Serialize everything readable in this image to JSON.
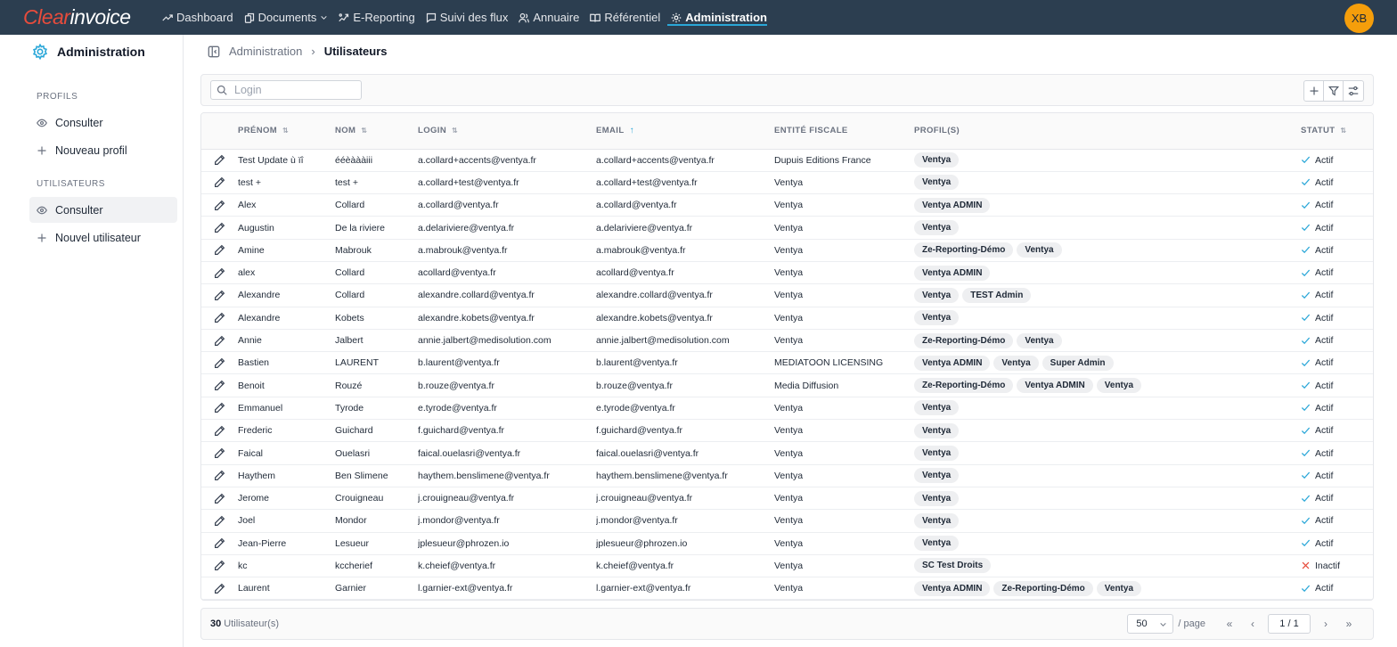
{
  "app": {
    "logo_a": "Clear",
    "logo_b": "invoice",
    "user_initials": "XB"
  },
  "nav": [
    {
      "label": "Dashboard",
      "icon": "trending-up-icon"
    },
    {
      "label": "Documents",
      "icon": "documents-icon",
      "dropdown": true
    },
    {
      "label": "E-Reporting",
      "icon": "e-reporting-icon"
    },
    {
      "label": "Suivi des flux",
      "icon": "message-icon"
    },
    {
      "label": "Annuaire",
      "icon": "users-icon"
    },
    {
      "label": "Référentiel",
      "icon": "book-icon"
    },
    {
      "label": "Administration",
      "icon": "gear-icon",
      "active": true
    }
  ],
  "sidebar": {
    "title": "Administration",
    "sections": [
      {
        "title": "PROFILS",
        "items": [
          {
            "label": "Consulter"
          },
          {
            "label": "Nouveau profil"
          }
        ]
      },
      {
        "title": "UTILISATEURS",
        "items": [
          {
            "label": "Consulter",
            "active": true
          },
          {
            "label": "Nouvel utilisateur"
          }
        ]
      }
    ]
  },
  "breadcrumb": {
    "parent": "Administration",
    "current": "Utilisateurs"
  },
  "search": {
    "placeholder": "Login",
    "value": ""
  },
  "table": {
    "columns": [
      "PRÉNOM",
      "NOM",
      "LOGIN",
      "EMAIL",
      "ENTITÉ FISCALE",
      "PROFIL(S)",
      "STATUT"
    ],
    "rows": [
      {
        "prenom": "Test Update ù ïî",
        "nom": "ééèàààiii",
        "login": "a.collard+accents@ventya.fr",
        "email": "a.collard+accents@ventya.fr",
        "entite": "Dupuis Editions France",
        "profils": [
          "Ventya"
        ],
        "statut": "Actif",
        "active": true
      },
      {
        "prenom": "test +",
        "nom": "test +",
        "login": "a.collard+test@ventya.fr",
        "email": "a.collard+test@ventya.fr",
        "entite": "Ventya",
        "profils": [
          "Ventya"
        ],
        "statut": "Actif",
        "active": true
      },
      {
        "prenom": "Alex",
        "nom": "Collard",
        "login": "a.collard@ventya.fr",
        "email": "a.collard@ventya.fr",
        "entite": "Ventya",
        "profils": [
          "Ventya ADMIN"
        ],
        "statut": "Actif",
        "active": true
      },
      {
        "prenom": "Augustin",
        "nom": "De la riviere",
        "login": "a.delariviere@ventya.fr",
        "email": "a.delariviere@ventya.fr",
        "entite": "Ventya",
        "profils": [
          "Ventya"
        ],
        "statut": "Actif",
        "active": true
      },
      {
        "prenom": "Amine",
        "nom": "Mabrouk",
        "login": "a.mabrouk@ventya.fr",
        "email": "a.mabrouk@ventya.fr",
        "entite": "Ventya",
        "profils": [
          "Ze-Reporting-Démo",
          "Ventya"
        ],
        "statut": "Actif",
        "active": true
      },
      {
        "prenom": "alex",
        "nom": "Collard",
        "login": "acollard@ventya.fr",
        "email": "acollard@ventya.fr",
        "entite": "Ventya",
        "profils": [
          "Ventya ADMIN"
        ],
        "statut": "Actif",
        "active": true
      },
      {
        "prenom": "Alexandre",
        "nom": "Collard",
        "login": "alexandre.collard@ventya.fr",
        "email": "alexandre.collard@ventya.fr",
        "entite": "Ventya",
        "profils": [
          "Ventya",
          "TEST Admin"
        ],
        "statut": "Actif",
        "active": true
      },
      {
        "prenom": "Alexandre",
        "nom": "Kobets",
        "login": "alexandre.kobets@ventya.fr",
        "email": "alexandre.kobets@ventya.fr",
        "entite": "Ventya",
        "profils": [
          "Ventya"
        ],
        "statut": "Actif",
        "active": true
      },
      {
        "prenom": "Annie",
        "nom": "Jalbert",
        "login": "annie.jalbert@medisolution.com",
        "email": "annie.jalbert@medisolution.com",
        "entite": "Ventya",
        "profils": [
          "Ze-Reporting-Démo",
          "Ventya"
        ],
        "statut": "Actif",
        "active": true
      },
      {
        "prenom": "Bastien",
        "nom": "LAURENT",
        "login": "b.laurent@ventya.fr",
        "email": "b.laurent@ventya.fr",
        "entite": "MEDIATOON LICENSING",
        "profils": [
          "Ventya ADMIN",
          "Ventya",
          "Super Admin"
        ],
        "statut": "Actif",
        "active": true
      },
      {
        "prenom": "Benoit",
        "nom": "Rouzé",
        "login": "b.rouze@ventya.fr",
        "email": "b.rouze@ventya.fr",
        "entite": "Media Diffusion",
        "profils": [
          "Ze-Reporting-Démo",
          "Ventya ADMIN",
          "Ventya"
        ],
        "statut": "Actif",
        "active": true
      },
      {
        "prenom": "Emmanuel",
        "nom": "Tyrode",
        "login": "e.tyrode@ventya.fr",
        "email": "e.tyrode@ventya.fr",
        "entite": "Ventya",
        "profils": [
          "Ventya"
        ],
        "statut": "Actif",
        "active": true
      },
      {
        "prenom": "Frederic",
        "nom": "Guichard",
        "login": "f.guichard@ventya.fr",
        "email": "f.guichard@ventya.fr",
        "entite": "Ventya",
        "profils": [
          "Ventya"
        ],
        "statut": "Actif",
        "active": true
      },
      {
        "prenom": "Faical",
        "nom": "Ouelasri",
        "login": "faical.ouelasri@ventya.fr",
        "email": "faical.ouelasri@ventya.fr",
        "entite": "Ventya",
        "profils": [
          "Ventya"
        ],
        "statut": "Actif",
        "active": true
      },
      {
        "prenom": "Haythem",
        "nom": "Ben Slimene",
        "login": "haythem.benslimene@ventya.fr",
        "email": "haythem.benslimene@ventya.fr",
        "entite": "Ventya",
        "profils": [
          "Ventya"
        ],
        "statut": "Actif",
        "active": true
      },
      {
        "prenom": "Jerome",
        "nom": "Crouigneau",
        "login": "j.crouigneau@ventya.fr",
        "email": "j.crouigneau@ventya.fr",
        "entite": "Ventya",
        "profils": [
          "Ventya"
        ],
        "statut": "Actif",
        "active": true
      },
      {
        "prenom": "Joel",
        "nom": "Mondor",
        "login": "j.mondor@ventya.fr",
        "email": "j.mondor@ventya.fr",
        "entite": "Ventya",
        "profils": [
          "Ventya"
        ],
        "statut": "Actif",
        "active": true
      },
      {
        "prenom": "Jean-Pierre",
        "nom": "Lesueur",
        "login": "jplesueur@phrozen.io",
        "email": "jplesueur@phrozen.io",
        "entite": "Ventya",
        "profils": [
          "Ventya"
        ],
        "statut": "Actif",
        "active": true
      },
      {
        "prenom": "kc",
        "nom": "kccherief",
        "login": "k.cheief@ventya.fr",
        "email": "k.cheief@ventya.fr",
        "entite": "Ventya",
        "profils": [
          "SC Test Droits"
        ],
        "statut": "Inactif",
        "active": false
      },
      {
        "prenom": "Laurent",
        "nom": "Garnier",
        "login": "l.garnier-ext@ventya.fr",
        "email": "l.garnier-ext@ventya.fr",
        "entite": "Ventya",
        "profils": [
          "Ventya ADMIN",
          "Ze-Reporting-Démo",
          "Ventya"
        ],
        "statut": "Actif",
        "active": true
      }
    ]
  },
  "footer": {
    "count": "30",
    "count_label": "Utilisateur(s)",
    "page_size": "50",
    "per_page": "/ page",
    "page": "1 / 1"
  },
  "colors": {
    "topbar": "#2c3e50",
    "accent": "#2aa7d8",
    "logo_red": "#e74c3c",
    "avatar": "#f59e0b",
    "inactive": "#e74c3c"
  }
}
